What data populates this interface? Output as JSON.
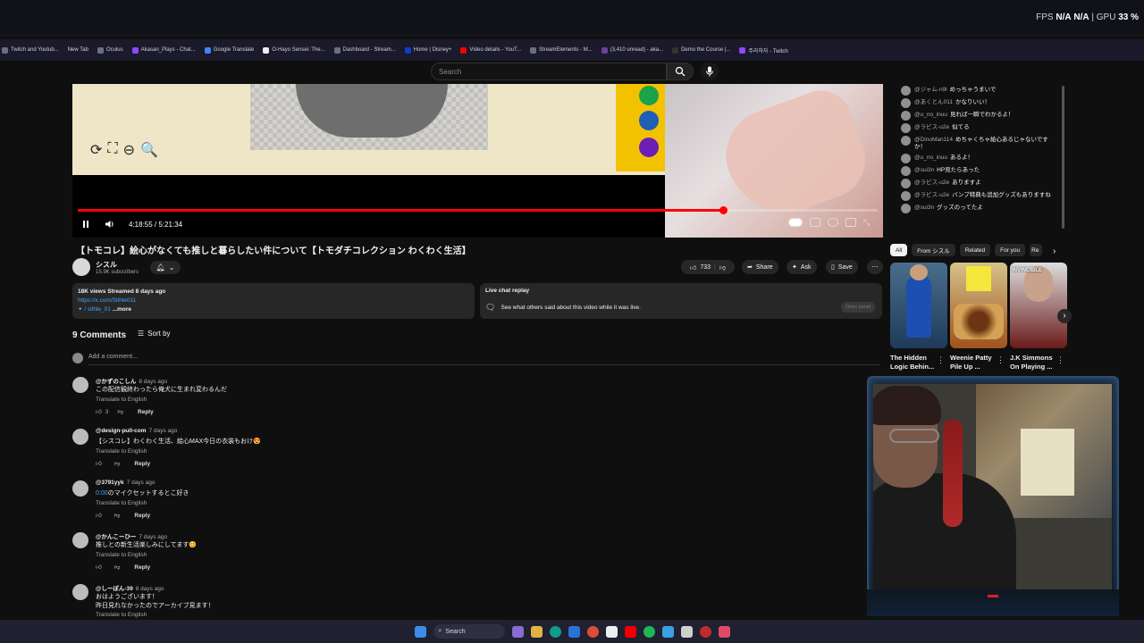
{
  "perf": {
    "fps_label": "FPS",
    "fps_v1": "N/A",
    "fps_v2": "N/A",
    "gpu_label": "GPU",
    "gpu_value": "33 %"
  },
  "bookmarks": [
    {
      "label": "Twitch and Youtub..."
    },
    {
      "label": "New Tab"
    },
    {
      "label": "Oculus"
    },
    {
      "label": "Akasan_Plays - Chat..."
    },
    {
      "label": "Google Translate"
    },
    {
      "label": "O-Hayo Sensei: The..."
    },
    {
      "label": "Dashboard - Stream..."
    },
    {
      "label": "Home | Disney+"
    },
    {
      "label": "Video details - YouT..."
    },
    {
      "label": "StreamElements - M..."
    },
    {
      "label": "(3,410 unread) - aka..."
    },
    {
      "label": "Demo the Course |..."
    },
    {
      "label": "주라하자 - Twitch"
    }
  ],
  "search": {
    "placeholder": "Search"
  },
  "player": {
    "time": "4:18:55 / 5:21:34",
    "progress": 0.807
  },
  "chat": [
    {
      "author": "@ジャム-n9l",
      "text": "めっちゃうまいで"
    },
    {
      "author": "@あくとん011",
      "text": "かなりいい！"
    },
    {
      "author": "@u_no_inuu",
      "text": "見れば一瞬でわかるよ！"
    },
    {
      "author": "@ラビス-u2e",
      "text": "似てる"
    },
    {
      "author": "@DinoMan114",
      "text": "めちゃくちゃ絵心あるじゃないですか！"
    },
    {
      "author": "@u_no_inuu",
      "text": "あるよ！"
    },
    {
      "author": "@sui3n",
      "text": "HP見たらあった"
    },
    {
      "author": "@ラビス-u2e",
      "text": "ありますよ"
    },
    {
      "author": "@ラビス-u2e",
      "text": "バンプ特典も追加グッズもありますね"
    },
    {
      "author": "@sui3n",
      "text": "グッズのってたよ"
    }
  ],
  "video": {
    "title": "【トモコレ】絵心がなくても推しと暮らしたい件について【トモダチコレクション わくわく生活】",
    "channel": "シスル",
    "subscribers": "15.9K subscribers",
    "likes": "733",
    "share": "Share",
    "ask": "Ask",
    "save": "Save"
  },
  "description": {
    "stats": "18K views  Streamed 8 days ago",
    "link": "https://x.com/Sithle011",
    "tag": "✦ / sithle_01",
    "more": "...more"
  },
  "replay": {
    "title": "Live chat replay",
    "text": "See what others said about this video while it was live.",
    "button": "Open panel"
  },
  "comments_header": {
    "count": "9 Comments",
    "sort": "Sort by",
    "add": "Add a comment..."
  },
  "comments": [
    {
      "author": "@かずのこしん",
      "age": "8 days ago",
      "text": "この配信観終わったら俺犬に生まれ変わるんだ",
      "translate": "Translate to English",
      "likes": "3",
      "reply": "Reply"
    },
    {
      "author": "@design-pull-com",
      "age": "7 days ago",
      "text": "【シスコレ】わくわく生活、絵心MAX今日の衣装もおけ😍",
      "translate": "Translate to English",
      "likes": "",
      "reply": "Reply"
    },
    {
      "author": "@3791yyk",
      "age": "7 days ago",
      "time_link": "0:00",
      "text": "のマイクセットするとこ好き",
      "translate": "Translate to English",
      "likes": "",
      "reply": "Reply"
    },
    {
      "author": "@かんこーひー",
      "age": "7 days ago",
      "text": "推しとの新生活楽しみにしてます😊",
      "translate": "Translate to English",
      "likes": "",
      "reply": "Reply"
    },
    {
      "author": "@しーぽん-39",
      "age": "8 days ago",
      "text": "おはようございます！",
      "text2": "昨日見れなかったのでアーカイブ見ます！",
      "translate": "Translate to English",
      "likes": "",
      "reply": "Reply"
    }
  ],
  "chips": [
    {
      "label": "All"
    },
    {
      "label": "From シスル"
    },
    {
      "label": "Related"
    },
    {
      "label": "For you"
    },
    {
      "label": "Re"
    }
  ],
  "related": [
    {
      "title1": "The Hidden",
      "title2": "Logic Behin..."
    },
    {
      "title1": "Weenie Patty",
      "title2": "Pile Up ..."
    },
    {
      "title1": "J.K Simmons",
      "title2": "On Playing ..."
    }
  ],
  "thumb_text": {
    "t3": "INVINCIBLE"
  },
  "taskbar": {
    "search": "Search"
  }
}
